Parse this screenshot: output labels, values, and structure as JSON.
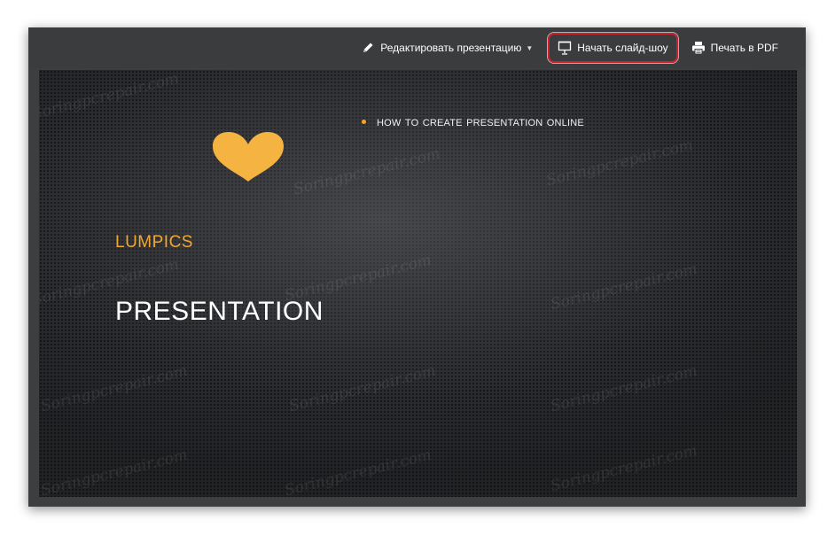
{
  "toolbar": {
    "edit_label": "Редактировать презентацию",
    "edit_icon": "pencil-icon",
    "slideshow_label": "Начать слайд-шоу",
    "slideshow_icon": "projector-screen-icon",
    "print_label": "Печать в PDF",
    "print_icon": "printer-icon",
    "highlight_color": "#d0202e"
  },
  "slide": {
    "bullet_text": "How to create presentation online",
    "subtitle": "LUMPICS",
    "title": "PRESENTATION",
    "decoration_icon": "heart-icon",
    "accent_color": "#f5a623",
    "heart_color": "#f5b342"
  },
  "watermark": {
    "text": "Soringpcrepair.com"
  }
}
